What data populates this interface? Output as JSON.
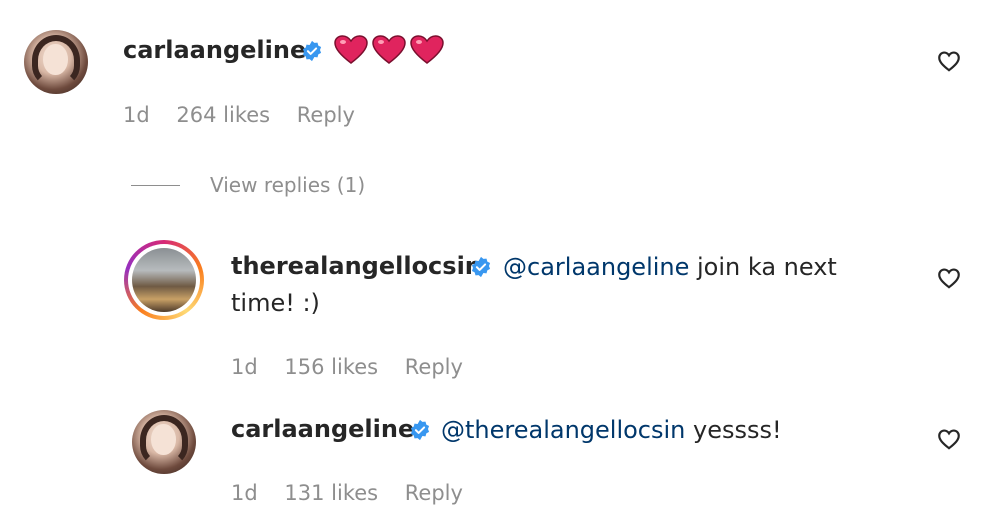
{
  "comments": [
    {
      "username": "carlaangeline",
      "text": "",
      "emoji": [
        "red-heart",
        "red-heart",
        "red-heart"
      ],
      "time": "1d",
      "likes": "264 likes",
      "reply": "Reply"
    }
  ],
  "view_replies": "View replies (1)",
  "replies": [
    {
      "username": "therealangellocsin",
      "mention": "@carlaangeline",
      "text_line1": " join ka next",
      "text_line2": "time! :)",
      "time": "1d",
      "likes": "156 likes",
      "reply": "Reply"
    },
    {
      "username": "carlaangeline",
      "mention": "@therealangellocsin",
      "text_line1": " yessss!",
      "time": "1d",
      "likes": "131 likes",
      "reply": "Reply"
    }
  ],
  "colors": {
    "verified": "#3897f0",
    "mention": "#00376b",
    "meta": "#8e8e8e",
    "heart_emoji": "#e0245e"
  }
}
